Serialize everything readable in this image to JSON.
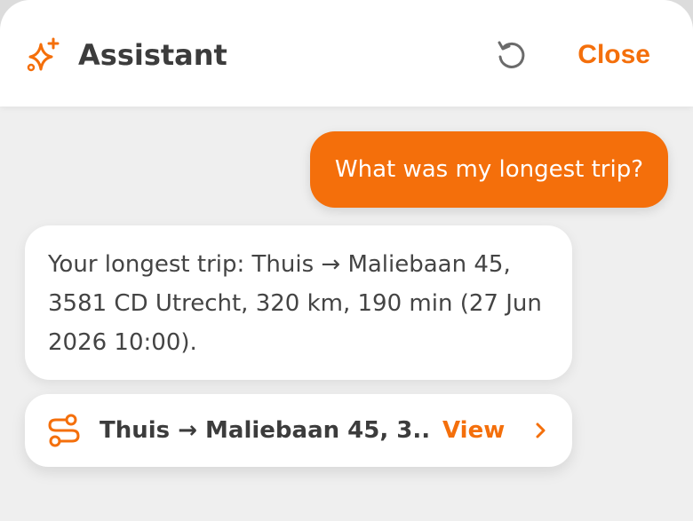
{
  "header": {
    "title": "Assistant",
    "close_label": "Close",
    "icon": "sparkle-icon",
    "reset_icon": "reset-icon"
  },
  "conversation": {
    "user_message": "What was my longest trip?",
    "assistant_message": "Your longest trip: Thuis → Maliebaan 45, 3581 CD Utrecht, 320 km, 190 min (27 Jun 2026 10:00)."
  },
  "trip_card": {
    "title": "Thuis → Maliebaan 45, 3...",
    "action_label": "View",
    "icon": "route-icon",
    "chevron": "chevron-right-icon"
  },
  "colors": {
    "accent": "#f46f0b",
    "text_dark": "#3c3c3c",
    "background": "#efefef"
  }
}
